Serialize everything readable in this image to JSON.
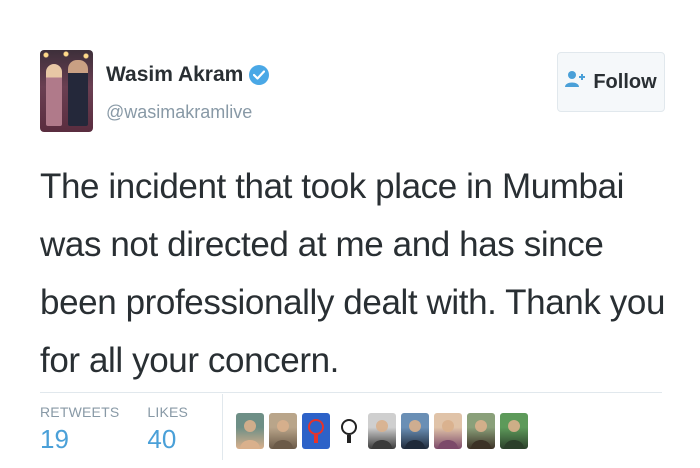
{
  "user": {
    "name": "Wasim Akram",
    "handle": "@wasimakramlive",
    "verified": true
  },
  "follow_button": {
    "label": "Follow",
    "icon": "add-user-icon"
  },
  "tweet": {
    "text": "The incident that took place in Mumbai was not directed at me and has since been professionally dealt with. Thank you for all your concern."
  },
  "stats": {
    "retweets_label": "RETWEETS",
    "retweets_value": "19",
    "likes_label": "LIKES",
    "likes_value": "40"
  },
  "colors": {
    "link_blue": "#4aa0d8",
    "verified_blue": "#4aa8e6",
    "muted_gray": "#8899a6",
    "text": "#292f33"
  },
  "liker_avatars": [
    {
      "kind": "photo",
      "palette": [
        "#6e8f86",
        "#d9b08c"
      ]
    },
    {
      "kind": "photo",
      "palette": [
        "#b9a58a",
        "#6b5a48"
      ]
    },
    {
      "kind": "logo",
      "palette": [
        "#2d62c8",
        "#e6332a"
      ]
    },
    {
      "kind": "logo",
      "palette": [
        "#ffffff",
        "#222222"
      ]
    },
    {
      "kind": "photo",
      "palette": [
        "#cfcfcf",
        "#3b3b3b"
      ]
    },
    {
      "kind": "photo",
      "palette": [
        "#6a8fb5",
        "#1f2a3a"
      ]
    },
    {
      "kind": "photo",
      "palette": [
        "#e0c3a8",
        "#7c4a6a"
      ]
    },
    {
      "kind": "photo",
      "palette": [
        "#8aa07a",
        "#3c3226"
      ]
    },
    {
      "kind": "photo",
      "palette": [
        "#5d9a5a",
        "#2b3f2a"
      ]
    }
  ]
}
